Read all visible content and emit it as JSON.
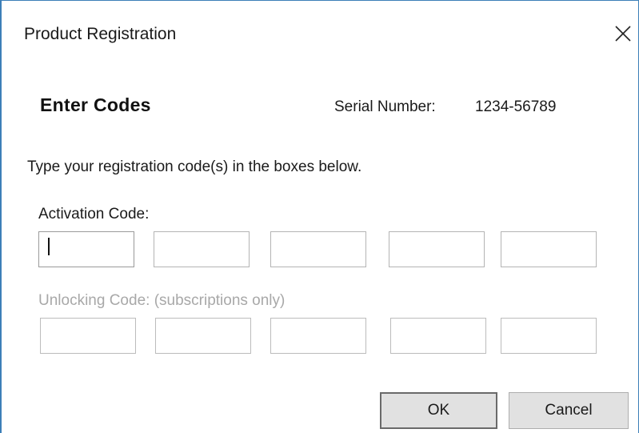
{
  "window": {
    "title": "Product Registration",
    "close_icon": "close-icon"
  },
  "header": {
    "heading": "Enter Codes",
    "serial_label": "Serial Number:",
    "serial_value": "1234-56789"
  },
  "instructions": "Type your registration code(s) in the boxes below.",
  "activation": {
    "label": "Activation Code:",
    "fields": [
      "",
      "",
      "",
      "",
      ""
    ]
  },
  "unlocking": {
    "label": "Unlocking Code: (subscriptions only)",
    "fields": [
      "",
      "",
      "",
      "",
      ""
    ],
    "disabled": true
  },
  "buttons": {
    "ok_label": "OK",
    "cancel_label": "Cancel"
  },
  "colors": {
    "window_border": "#3c7fb8",
    "disabled_text": "#a8a8a8",
    "button_face": "#e1e1e1"
  }
}
